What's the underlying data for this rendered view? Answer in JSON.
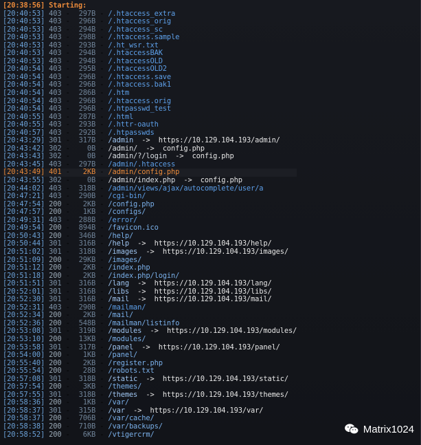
{
  "lines": [
    {
      "t": "[20:38:56]",
      "c": "",
      "s": "",
      "p": "Starting:",
      "cls": "start"
    },
    {
      "t": "[20:40:53]",
      "c": "403",
      "s": "297B",
      "p": "/.htaccess_extra",
      "cls": "s403"
    },
    {
      "t": "[20:40:53]",
      "c": "403",
      "s": "296B",
      "p": "/.htaccess_orig",
      "cls": "s403"
    },
    {
      "t": "[20:40:53]",
      "c": "403",
      "s": "294B",
      "p": "/.htaccess_sc",
      "cls": "s403"
    },
    {
      "t": "[20:40:53]",
      "c": "403",
      "s": "298B",
      "p": "/.htaccess.sample",
      "cls": "s403"
    },
    {
      "t": "[20:40:53]",
      "c": "403",
      "s": "293B",
      "p": "/.ht_wsr.txt",
      "cls": "s403"
    },
    {
      "t": "[20:40:53]",
      "c": "403",
      "s": "294B",
      "p": "/.htaccessBAK",
      "cls": "s403"
    },
    {
      "t": "[20:40:53]",
      "c": "403",
      "s": "294B",
      "p": "/.htaccessOLD",
      "cls": "s403"
    },
    {
      "t": "[20:40:54]",
      "c": "403",
      "s": "295B",
      "p": "/.htaccessOLD2",
      "cls": "s403"
    },
    {
      "t": "[20:40:54]",
      "c": "403",
      "s": "296B",
      "p": "/.htaccess.save",
      "cls": "s403"
    },
    {
      "t": "[20:40:54]",
      "c": "403",
      "s": "296B",
      "p": "/.htaccess.bak1",
      "cls": "s403"
    },
    {
      "t": "[20:40:54]",
      "c": "403",
      "s": "286B",
      "p": "/.htm",
      "cls": "s403"
    },
    {
      "t": "[20:40:54]",
      "c": "403",
      "s": "296B",
      "p": "/.htaccess.orig",
      "cls": "s403"
    },
    {
      "t": "[20:40:54]",
      "c": "403",
      "s": "296B",
      "p": "/.htpasswd_test",
      "cls": "s403"
    },
    {
      "t": "[20:40:55]",
      "c": "403",
      "s": "287B",
      "p": "/.html",
      "cls": "s403"
    },
    {
      "t": "[20:40:55]",
      "c": "403",
      "s": "293B",
      "p": "/.httr-oauth",
      "cls": "s403"
    },
    {
      "t": "[20:40:57]",
      "c": "403",
      "s": "292B",
      "p": "/.htpasswds",
      "cls": "s403"
    },
    {
      "t": "[20:43:29]",
      "c": "301",
      "s": "317B",
      "p": "/admin",
      "r": "https://10.129.104.193/admin/",
      "cls": "s301"
    },
    {
      "t": "[20:43:42]",
      "c": "302",
      "s": "0B",
      "p": "/admin/",
      "r": "config.php",
      "cls": "s302"
    },
    {
      "t": "[20:43:43]",
      "c": "302",
      "s": "0B",
      "p": "/admin/?/login",
      "r": "config.php",
      "cls": "s302"
    },
    {
      "t": "[20:43:45]",
      "c": "403",
      "s": "297B",
      "p": "/admin/.htaccess",
      "cls": "s403"
    },
    {
      "t": "[20:43:49]",
      "c": "401",
      "s": "2KB",
      "p": "/admin/config.php",
      "cls": "s401"
    },
    {
      "t": "[20:43:55]",
      "c": "302",
      "s": "0B",
      "p": "/admin/index.php",
      "r": "config.php",
      "cls": "s302"
    },
    {
      "t": "[20:44:02]",
      "c": "403",
      "s": "318B",
      "p": "/admin/views/ajax/autocomplete/user/a",
      "cls": "s403"
    },
    {
      "t": "[20:47:21]",
      "c": "403",
      "s": "290B",
      "p": "/cgi-bin/",
      "cls": "s403"
    },
    {
      "t": "[20:47:54]",
      "c": "200",
      "s": "2KB",
      "p": "/config.php",
      "cls": "s200"
    },
    {
      "t": "[20:47:57]",
      "c": "200",
      "s": "1KB",
      "p": "/configs/",
      "cls": "s200"
    },
    {
      "t": "[20:49:31]",
      "c": "403",
      "s": "288B",
      "p": "/error/",
      "cls": "s403"
    },
    {
      "t": "[20:49:54]",
      "c": "200",
      "s": "894B",
      "p": "/favicon.ico",
      "cls": "s200"
    },
    {
      "t": "[20:50:43]",
      "c": "200",
      "s": "346B",
      "p": "/help/",
      "cls": "s200"
    },
    {
      "t": "[20:50:44]",
      "c": "301",
      "s": "316B",
      "p": "/help",
      "r": "https://10.129.104.193/help/",
      "cls": "s301"
    },
    {
      "t": "[20:51:02]",
      "c": "301",
      "s": "318B",
      "p": "/images",
      "r": "https://10.129.104.193/images/",
      "cls": "s301"
    },
    {
      "t": "[20:51:09]",
      "c": "200",
      "s": "29KB",
      "p": "/images/",
      "cls": "s200"
    },
    {
      "t": "[20:51:12]",
      "c": "200",
      "s": "2KB",
      "p": "/index.php",
      "cls": "s200"
    },
    {
      "t": "[20:51:18]",
      "c": "200",
      "s": "2KB",
      "p": "/index.php/login/",
      "cls": "s200"
    },
    {
      "t": "[20:51:51]",
      "c": "301",
      "s": "316B",
      "p": "/lang",
      "r": "https://10.129.104.193/lang/",
      "cls": "s301"
    },
    {
      "t": "[20:52:01]",
      "c": "301",
      "s": "316B",
      "p": "/libs",
      "r": "https://10.129.104.193/libs/",
      "cls": "s301"
    },
    {
      "t": "[20:52:30]",
      "c": "301",
      "s": "316B",
      "p": "/mail",
      "r": "https://10.129.104.193/mail/",
      "cls": "s301"
    },
    {
      "t": "[20:52:31]",
      "c": "403",
      "s": "290B",
      "p": "/mailman/",
      "cls": "s403"
    },
    {
      "t": "[20:52:34]",
      "c": "200",
      "s": "2KB",
      "p": "/mail/",
      "cls": "s200"
    },
    {
      "t": "[20:52:36]",
      "c": "200",
      "s": "548B",
      "p": "/mailman/listinfo",
      "cls": "s200"
    },
    {
      "t": "[20:53:08]",
      "c": "301",
      "s": "319B",
      "p": "/modules",
      "r": "https://10.129.104.193/modules/",
      "cls": "s301"
    },
    {
      "t": "[20:53:10]",
      "c": "200",
      "s": "13KB",
      "p": "/modules/",
      "cls": "s200"
    },
    {
      "t": "[20:53:58]",
      "c": "301",
      "s": "317B",
      "p": "/panel",
      "r": "https://10.129.104.193/panel/",
      "cls": "s301"
    },
    {
      "t": "[20:54:00]",
      "c": "200",
      "s": "1KB",
      "p": "/panel/",
      "cls": "s200"
    },
    {
      "t": "[20:55:40]",
      "c": "200",
      "s": "2KB",
      "p": "/register.php",
      "cls": "s200"
    },
    {
      "t": "[20:55:54]",
      "c": "200",
      "s": "28B",
      "p": "/robots.txt",
      "cls": "s200"
    },
    {
      "t": "[20:57:08]",
      "c": "301",
      "s": "318B",
      "p": "/static",
      "r": "https://10.129.104.193/static/",
      "cls": "s301"
    },
    {
      "t": "[20:57:54]",
      "c": "200",
      "s": "3KB",
      "p": "/themes/",
      "cls": "s200"
    },
    {
      "t": "[20:57:55]",
      "c": "301",
      "s": "318B",
      "p": "/themes",
      "r": "https://10.129.104.193/themes/",
      "cls": "s301"
    },
    {
      "t": "[20:58:36]",
      "c": "200",
      "s": "1KB",
      "p": "/var/",
      "cls": "s200"
    },
    {
      "t": "[20:58:37]",
      "c": "301",
      "s": "315B",
      "p": "/var",
      "r": "https://10.129.104.193/var/",
      "cls": "s301"
    },
    {
      "t": "[20:58:37]",
      "c": "200",
      "s": "706B",
      "p": "/var/cache/",
      "cls": "s200"
    },
    {
      "t": "[20:58:38]",
      "c": "200",
      "s": "710B",
      "p": "/var/backups/",
      "cls": "s200"
    },
    {
      "t": "[20:58:52]",
      "c": "200",
      "s": "6KB",
      "p": "/vtigercrm/",
      "cls": "s200"
    }
  ],
  "watermark": {
    "text": "Matrix1024",
    "icon": "wechat-icon"
  },
  "colors": {
    "status_403": "#5d9fe8",
    "status_401": "#e8893a",
    "status_200": "#7ab0ea",
    "background": "#15181e"
  }
}
